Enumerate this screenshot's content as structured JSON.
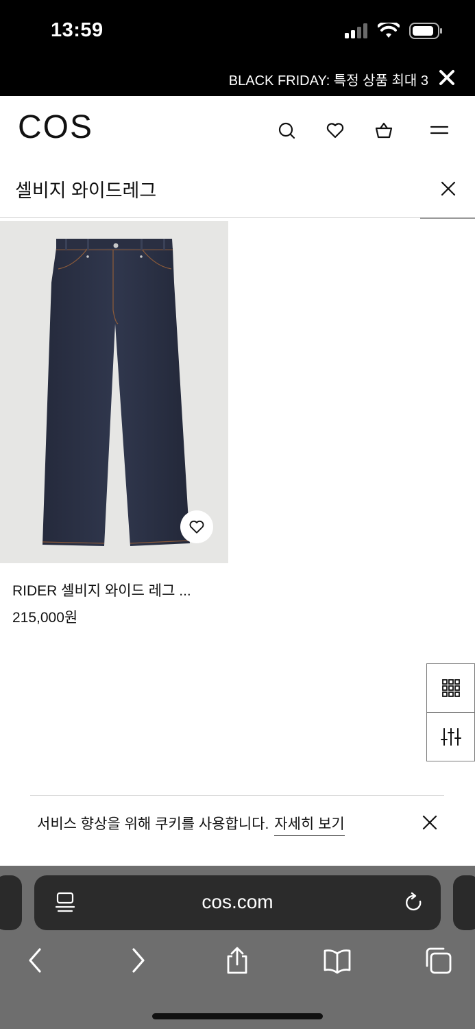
{
  "status_bar": {
    "time": "13:59",
    "signal_icon": "cellular-signal-icon",
    "wifi_icon": "wifi-icon",
    "battery_icon": "battery-icon"
  },
  "promo": {
    "text": "BLACK FRIDAY: 특정 상품 최대 3",
    "close_icon": "close-icon"
  },
  "header": {
    "logo": "COS",
    "icons": [
      "search-icon",
      "heart-icon",
      "basket-icon",
      "menu-icon"
    ]
  },
  "search": {
    "query": "셀비지 와이드레그",
    "clear_icon": "close-icon"
  },
  "product": {
    "name": "RIDER 셀비지 와이드 레그 ...",
    "price": "215,000원",
    "wishlist_icon": "heart-icon",
    "image_desc_icon": "jeans-image"
  },
  "controls": {
    "grid_icon": "grid-view-icon",
    "filter_icon": "filter-sliders-icon"
  },
  "cookie": {
    "text": "서비스 향상을 위해 쿠키를 사용합니다.",
    "link": "자세히 보기",
    "close_icon": "close-icon"
  },
  "browser": {
    "url": "cos.com",
    "reader_icon": "page-menu-icon",
    "reload_icon": "reload-icon",
    "toolbar": [
      "back-icon",
      "forward-icon",
      "share-icon",
      "bookmarks-icon",
      "tabs-icon"
    ]
  },
  "colors": {
    "black": "#000000",
    "chrome_gray": "#6e6e6e",
    "url_bar": "#2b2b2b",
    "denim": "#2b3145"
  }
}
